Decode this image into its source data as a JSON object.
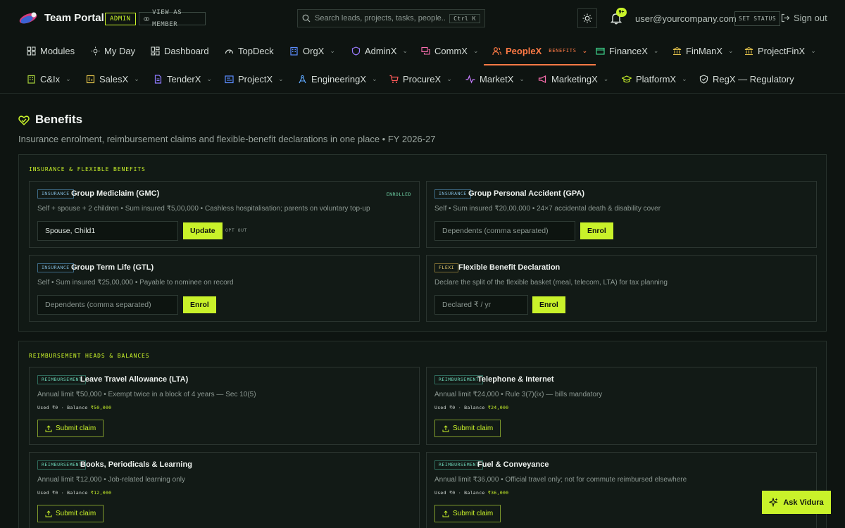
{
  "brand": {
    "name": "Team Portal",
    "admin_badge": "ADMIN",
    "view_as_member": "VIEW AS MEMBER"
  },
  "search": {
    "placeholder": "Search leads, projects, tasks, people...",
    "shortcut": "Ctrl K"
  },
  "notifications": {
    "badge": "9+"
  },
  "user": {
    "email": "user@yourcompany.com",
    "set_status": "SET STATUS",
    "sign_out": "Sign out"
  },
  "nav_row1": [
    {
      "label": "Modules",
      "icon": "grid-icon"
    },
    {
      "label": "My Day",
      "icon": "sun-icon"
    },
    {
      "label": "Dashboard",
      "icon": "dashboard-icon"
    },
    {
      "label": "TopDeck",
      "icon": "gauge-icon"
    },
    {
      "label": "OrgX",
      "icon": "building-icon"
    },
    {
      "label": "AdminX",
      "icon": "shield-icon"
    },
    {
      "label": "CommX",
      "icon": "chat-icon"
    },
    {
      "label": "PeopleX",
      "sub": "BENEFITS",
      "icon": "people-icon"
    },
    {
      "label": "FinanceX",
      "icon": "wallet-icon"
    },
    {
      "label": "FinManX",
      "icon": "bank-icon"
    },
    {
      "label": "ProjectFinX",
      "icon": "bank-icon"
    }
  ],
  "nav_row2": [
    {
      "label": "C&Ix",
      "icon": "building-icon"
    },
    {
      "label": "SalesX",
      "icon": "sales-icon"
    },
    {
      "label": "TenderX",
      "icon": "document-icon"
    },
    {
      "label": "ProjectX",
      "icon": "project-icon"
    },
    {
      "label": "EngineeringX",
      "icon": "compass-icon"
    },
    {
      "label": "ProcureX",
      "icon": "cart-icon"
    },
    {
      "label": "MarketX",
      "icon": "pulse-icon"
    },
    {
      "label": "MarketingX",
      "icon": "megaphone-icon"
    },
    {
      "label": "PlatformX",
      "icon": "graduation-icon"
    },
    {
      "label": "RegX — Regulatory",
      "icon": "shield-check-icon"
    }
  ],
  "page": {
    "title": "Benefits",
    "subtitle": "Insurance enrolment, reimbursement claims and flexible-benefit declarations in one place • FY 2026-27"
  },
  "insurance_section": {
    "title": "INSURANCE & FLEXIBLE BENEFITS",
    "cards": [
      {
        "tag": "INSURANCE",
        "title": "Group Mediclaim (GMC)",
        "status": "ENROLLED",
        "desc": "Self + spouse + 2 children • Sum insured ₹5,00,000 • Cashless hospitalisation; parents on voluntary top-up",
        "input_value": "Spouse, Child1",
        "input_placeholder": "Dependents (comma separated)",
        "button": "Update",
        "secondary": "OPT OUT"
      },
      {
        "tag": "INSURANCE",
        "title": "Group Personal Accident (GPA)",
        "desc": "Self • Sum insured ₹20,00,000 • 24×7 accidental death & disability cover",
        "input_placeholder": "Dependents (comma separated)",
        "button": "Enrol"
      },
      {
        "tag": "INSURANCE",
        "title": "Group Term Life (GTL)",
        "desc": "Self • Sum insured ₹25,00,000 • Payable to nominee on record",
        "input_placeholder": "Dependents (comma separated)",
        "button": "Enrol"
      },
      {
        "tag": "FLEXI",
        "title": "Flexible Benefit Declaration",
        "desc": "Declare the split of the flexible basket (meal, telecom, LTA) for tax planning",
        "input_placeholder": "Declared ₹ / yr",
        "button": "Enrol"
      }
    ]
  },
  "reimbursement_section": {
    "title": "REIMBURSEMENT HEADS & BALANCES",
    "used_label": "Used",
    "balance_label": "Balance",
    "submit_label": "Submit claim",
    "cards": [
      {
        "tag": "REIMBURSEMENT",
        "title": "Leave Travel Allowance (LTA)",
        "desc": "Annual limit ₹50,000 • Exempt twice in a block of 4 years — Sec 10(5)",
        "used": "₹0",
        "balance": "₹50,000"
      },
      {
        "tag": "REIMBURSEMENT",
        "title": "Telephone & Internet",
        "desc": "Annual limit ₹24,000 • Rule 3(7)(ix) — bills mandatory",
        "used": "₹0",
        "balance": "₹24,000"
      },
      {
        "tag": "REIMBURSEMENT",
        "title": "Books, Periodicals & Learning",
        "desc": "Annual limit ₹12,000 • Job-related learning only",
        "used": "₹0",
        "balance": "₹12,000"
      },
      {
        "tag": "REIMBURSEMENT",
        "title": "Fuel & Conveyance",
        "desc": "Annual limit ₹36,000 • Official travel only; not for commute reimbursed elsewhere",
        "used": "₹0",
        "balance": "₹36,000"
      }
    ]
  },
  "assistant": {
    "label": "Ask Vidura"
  },
  "colors": {
    "accent": "#c9f22a",
    "active_nav": "#ff7a45",
    "background": "#0e1411"
  }
}
